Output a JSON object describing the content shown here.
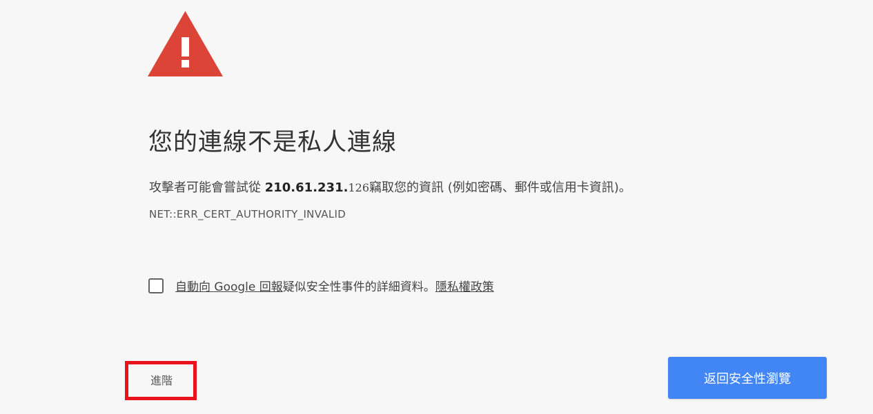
{
  "colors": {
    "background": "#f7f7f7",
    "warning_red": "#db4437",
    "primary_blue": "#4285f4",
    "highlight_red": "#e8131b"
  },
  "icons": {
    "warning": "warning-triangle-icon"
  },
  "title": "您的連線不是私人連線",
  "description": {
    "prefix": "攻擊者可能會嘗試從 ",
    "host_bold": "210.61.231.",
    "host_light": "126",
    "suffix": "竊取您的資訊 (例如密碼、郵件或信用卡資訊)。"
  },
  "error_code": "NET::ERR_CERT_AUTHORITY_INVALID",
  "report": {
    "checked": false,
    "link_text": "自動向 Google 回報",
    "middle_text": "疑似安全性事件的詳細資料。",
    "privacy_link": "隱私權政策"
  },
  "buttons": {
    "advanced": "進階",
    "back_to_safety": "返回安全性瀏覽"
  }
}
